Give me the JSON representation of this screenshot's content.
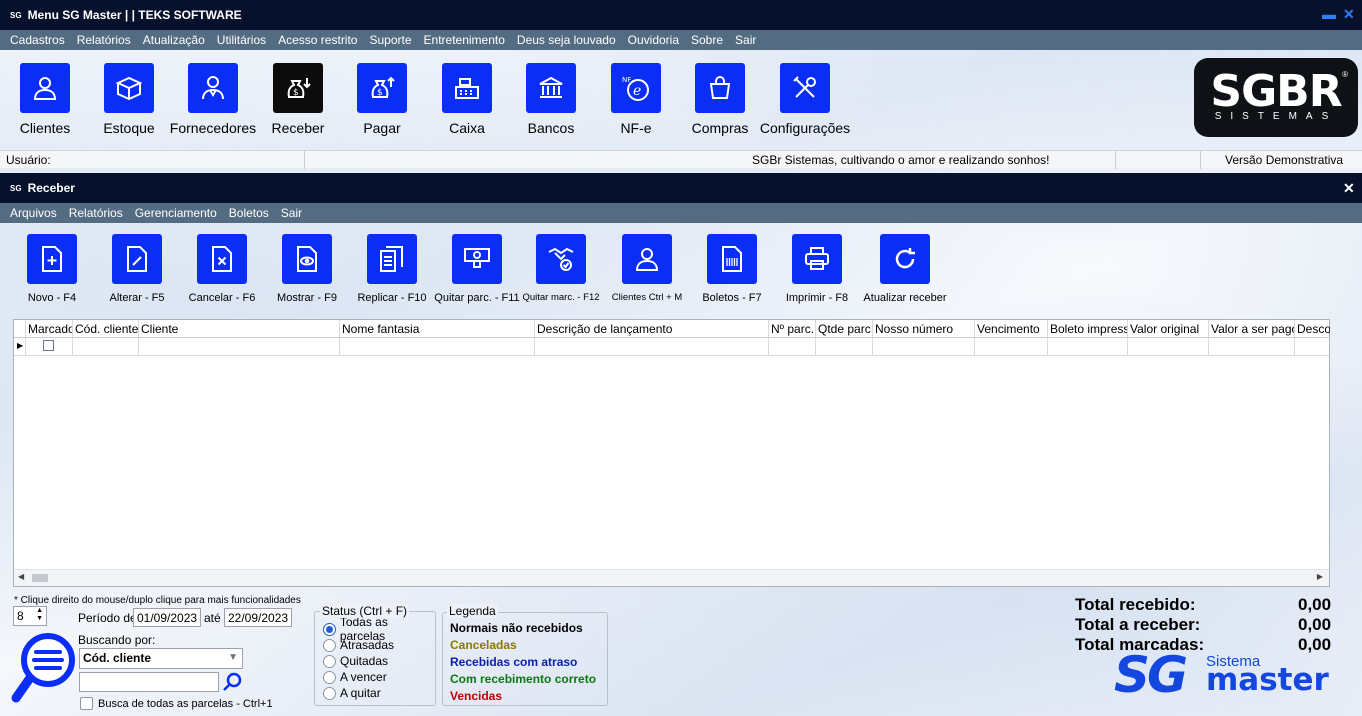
{
  "main_window": {
    "logo_small": "SG",
    "title": "Menu SG Master | | TEKS SOFTWARE",
    "minimize_glyph": "▬",
    "close_glyph": "✕"
  },
  "main_menu": [
    "Cadastros",
    "Relatórios",
    "Atualização",
    "Utilitários",
    "Acesso restrito",
    "Suporte",
    "Entretenimento",
    "Deus seja louvado",
    "Ouvidoria",
    "Sobre",
    "Sair"
  ],
  "main_toolbar": [
    {
      "label": "Clientes",
      "icon": "user-icon"
    },
    {
      "label": "Estoque",
      "icon": "box-icon"
    },
    {
      "label": "Fornecedores",
      "icon": "supplier-icon"
    },
    {
      "label": "Receber",
      "icon": "money-bag-in-icon"
    },
    {
      "label": "Pagar",
      "icon": "money-bag-out-icon"
    },
    {
      "label": "Caixa",
      "icon": "cash-register-icon"
    },
    {
      "label": "Bancos",
      "icon": "bank-icon"
    },
    {
      "label": "NF-e",
      "icon": "nfe-icon"
    },
    {
      "label": "Compras",
      "icon": "shopping-bag-icon"
    },
    {
      "label": "Configurações",
      "icon": "tools-icon"
    }
  ],
  "brand_logo": {
    "big": "SGBR",
    "small": "SISTEMAS",
    "reg": "®"
  },
  "status_bar": {
    "user_label": "Usuário:",
    "slogan": "SGBr Sistemas, cultivando o amor e realizando sonhos!",
    "version": "Versão Demonstrativa"
  },
  "receber_window": {
    "logo_small": "SG",
    "title": "Receber",
    "close_glyph": "✕"
  },
  "receber_menu": [
    "Arquivos",
    "Relatórios",
    "Gerenciamento",
    "Boletos",
    "Sair"
  ],
  "receber_toolbar": [
    {
      "label": "Novo - F4",
      "icon": "new-doc-icon"
    },
    {
      "label": "Alterar - F5",
      "icon": "edit-doc-icon"
    },
    {
      "label": "Cancelar - F6",
      "icon": "cancel-doc-icon"
    },
    {
      "label": "Mostrar - F9",
      "icon": "view-doc-icon"
    },
    {
      "label": "Replicar - F10",
      "icon": "copy-doc-icon"
    },
    {
      "label": "Quitar parc. - F11",
      "icon": "pay-icon"
    },
    {
      "label": "Quitar marc. - F12",
      "icon": "handshake-icon"
    },
    {
      "label": "Clientes Ctrl + M",
      "icon": "user-icon"
    },
    {
      "label": "Boletos - F7",
      "icon": "barcode-doc-icon"
    },
    {
      "label": "Imprimir - F8",
      "icon": "printer-icon"
    },
    {
      "label": "Atualizar receber",
      "icon": "refresh-icon"
    }
  ],
  "grid": {
    "columns": [
      "Marcado",
      "Cód. cliente",
      "Cliente",
      "Nome fantasia",
      "Descrição de lançamento",
      "Nº parc.",
      "Qtde parc.",
      "Nosso número",
      "Vencimento",
      "Boleto impresso",
      "Valor original",
      "Valor a ser pago",
      "Descor"
    ],
    "row_indicator": "▶",
    "scroll_left": "◀",
    "scroll_right": "▶"
  },
  "filters": {
    "hint": "* Clique direito do mouse/duplo clique para mais funcionalidades",
    "month": "8",
    "periodo_label": "Período de",
    "date_from": "01/09/2023",
    "ate_label": "até",
    "date_to": "22/09/2023",
    "buscando_label": "Buscando por:",
    "buscando_value": "Cód. cliente",
    "search_value": "",
    "busca_todas_label": "Busca de todas as parcelas - Ctrl+1"
  },
  "status_group": {
    "title": "Status (Ctrl + F)",
    "options": [
      "Todas as parcelas",
      "Atrasadas",
      "Quitadas",
      "A vencer",
      "A quitar"
    ],
    "selected": "Todas as parcelas"
  },
  "legenda": {
    "title": "Legenda",
    "items": [
      {
        "label": "Normais não recebidos",
        "color": "#000000"
      },
      {
        "label": "Canceladas",
        "color": "#8a7a00"
      },
      {
        "label": "Recebidas com atraso",
        "color": "#0b1fa8"
      },
      {
        "label": "Com recebimento correto",
        "color": "#0b7a10"
      },
      {
        "label": "Vencidas",
        "color": "#c00000"
      }
    ]
  },
  "totals": {
    "recebido_label": "Total recebido:",
    "recebido_value": "0,00",
    "receber_label": "Total a receber:",
    "receber_value": "0,00",
    "marcadas_label": "Total marcadas:",
    "marcadas_value": "0,00"
  },
  "footer_logo": {
    "sg": "SG",
    "sistema": "Sistema",
    "master": "master"
  },
  "colors": {
    "accent": "#0a2ef5",
    "titlebar": "#07112b",
    "menubar": "#546c82"
  }
}
